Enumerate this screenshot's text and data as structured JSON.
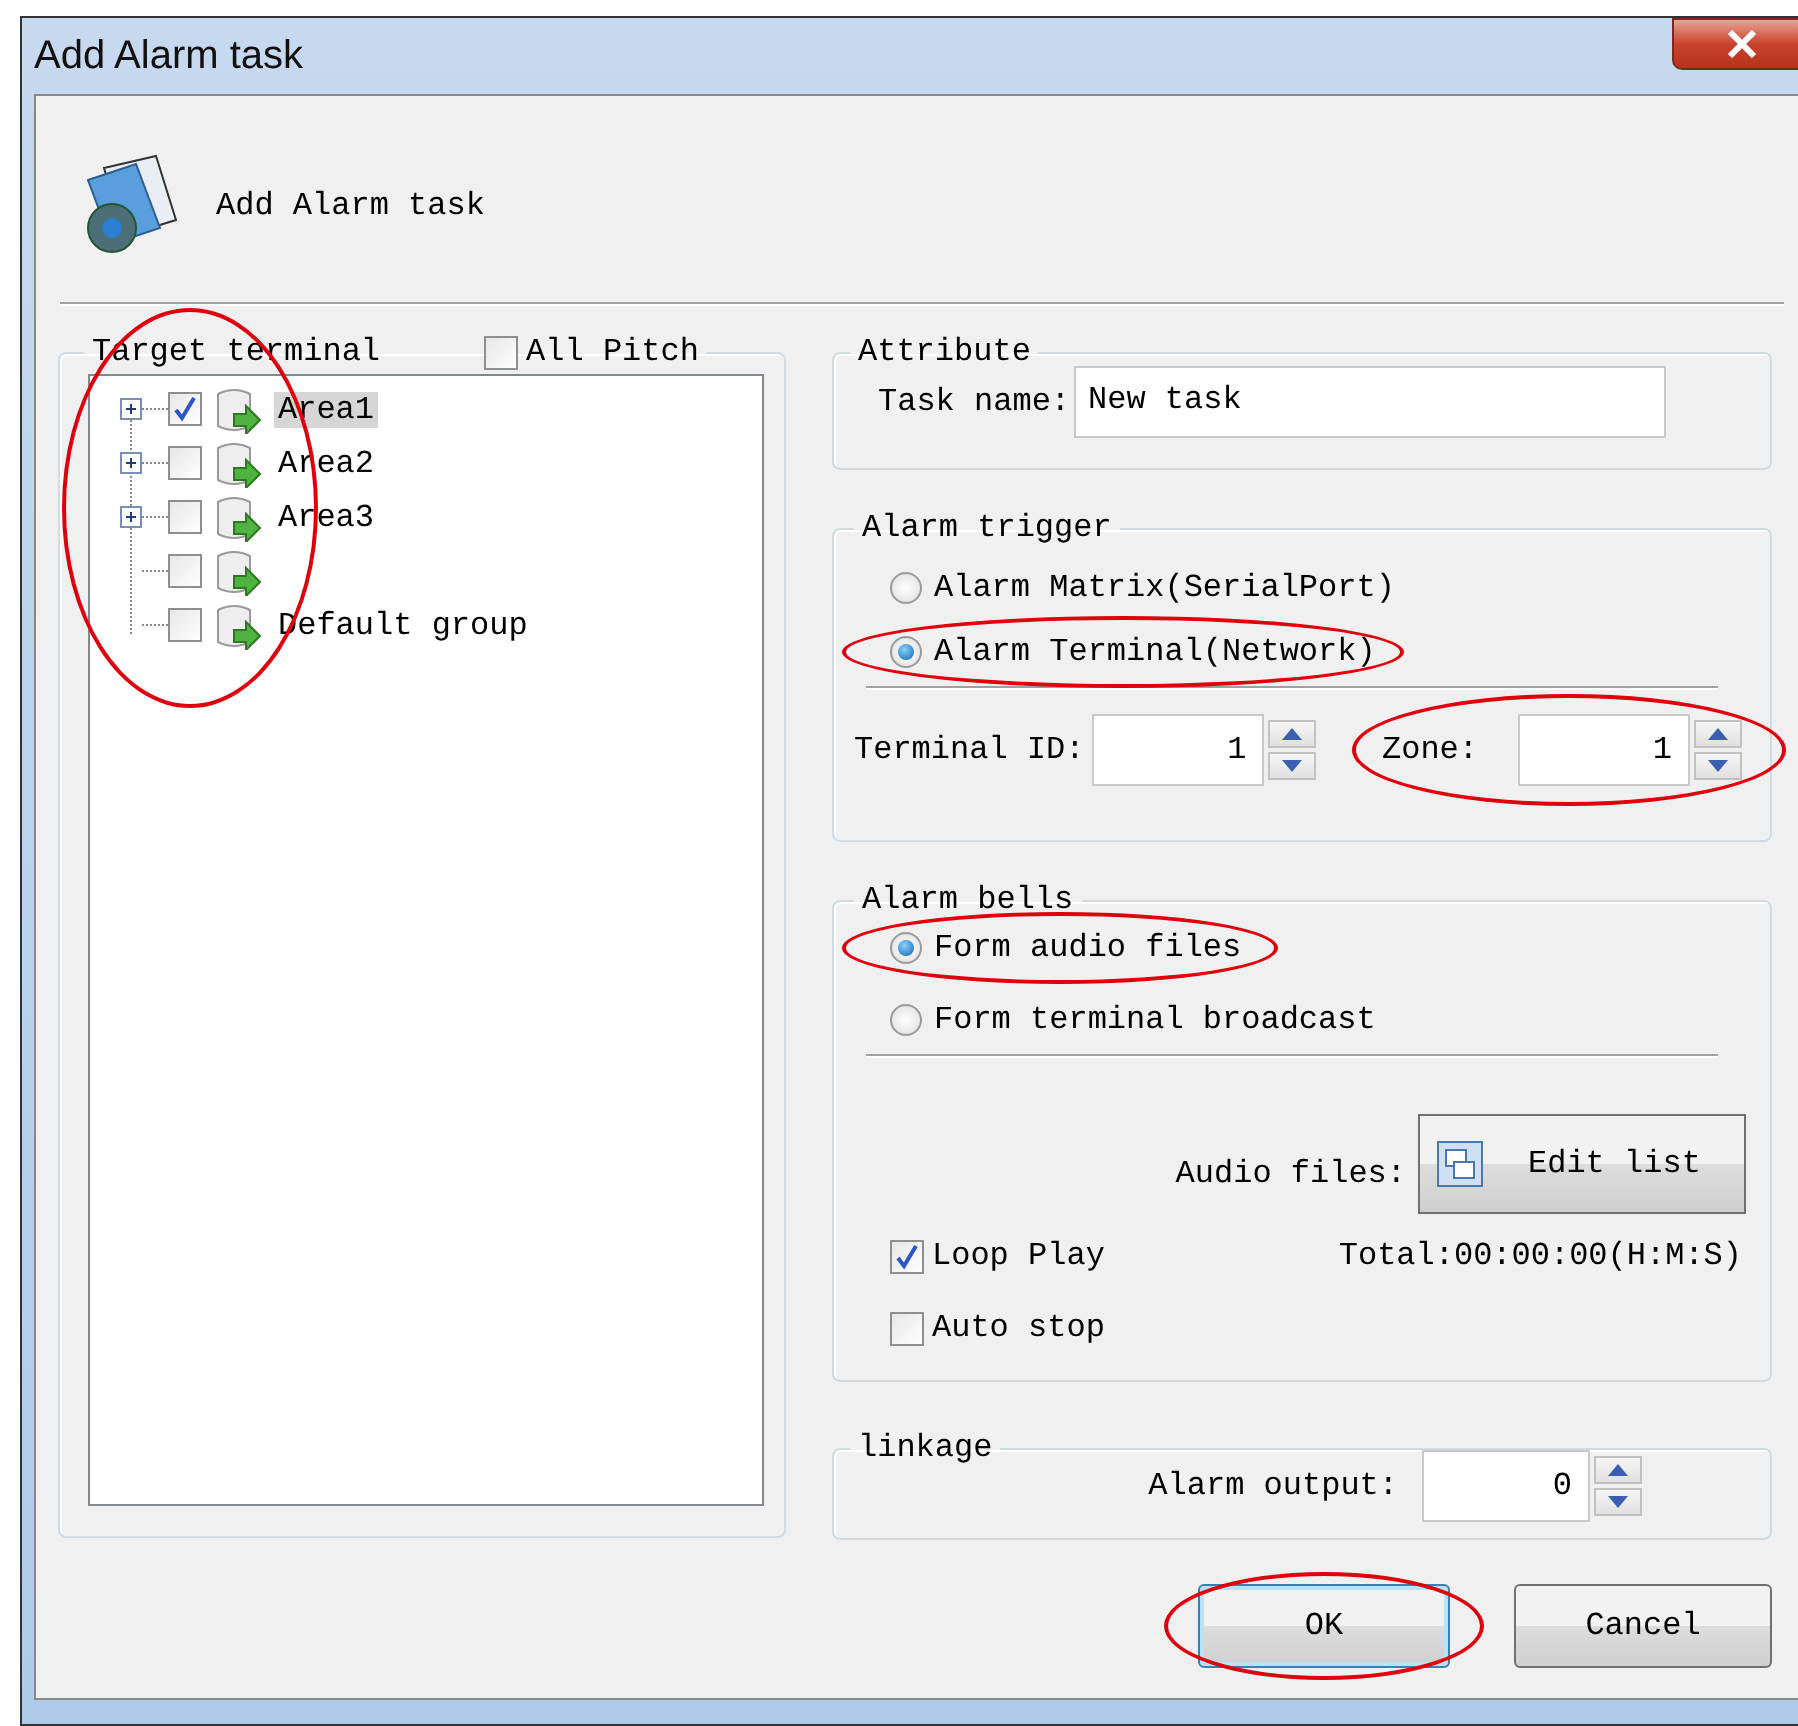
{
  "window": {
    "title": "Add Alarm task"
  },
  "header": {
    "title": "Add Alarm task"
  },
  "target_terminal": {
    "title": "Target terminal",
    "all_pitch": {
      "label": "All Pitch",
      "checked": false
    },
    "circled": true,
    "tree": [
      {
        "label": "Area1",
        "checked": true,
        "selected": true,
        "expandable": true
      },
      {
        "label": "Area2",
        "checked": false,
        "selected": false,
        "expandable": true
      },
      {
        "label": "Area3",
        "checked": false,
        "selected": false,
        "expandable": true
      },
      {
        "checked": false,
        "selected": false,
        "expandable": false
      },
      {
        "label": "Default group",
        "checked": false,
        "selected": false,
        "expandable": false
      }
    ]
  },
  "attribute": {
    "title": "Attribute",
    "task_name": {
      "label": "Task name:",
      "value": "New task"
    }
  },
  "alarm_trigger": {
    "title": "Alarm trigger",
    "options": [
      {
        "label": "Alarm Matrix(SerialPort)",
        "selected": false,
        "circled": false
      },
      {
        "label": "Alarm Terminal(Network)",
        "selected": true,
        "circled": true
      }
    ],
    "terminal_id": {
      "label": "Terminal ID:",
      "value": "1",
      "circled": false
    },
    "zone": {
      "label": "Zone:",
      "value": "1",
      "circled": true
    }
  },
  "alarm_bells": {
    "title": "Alarm bells",
    "options": [
      {
        "label": "Form audio files",
        "selected": true,
        "circled": true
      },
      {
        "label": "Form terminal broadcast",
        "selected": false,
        "circled": false
      }
    ],
    "audio_files_label": "Audio files:",
    "edit_button": "Edit list",
    "loop_play": {
      "label": "Loop Play",
      "checked": true
    },
    "total": "Total:00:00:00(H:M:S)",
    "auto_stop": {
      "label": "Auto stop",
      "checked": false
    }
  },
  "linkage": {
    "title": "linkage",
    "alarm_output": {
      "label": "Alarm output:",
      "value": "0",
      "circled": false
    }
  },
  "buttons": [
    {
      "label": "OK",
      "default": true,
      "circled": true
    },
    {
      "label": "Cancel",
      "default": false,
      "circled": false
    }
  ]
}
